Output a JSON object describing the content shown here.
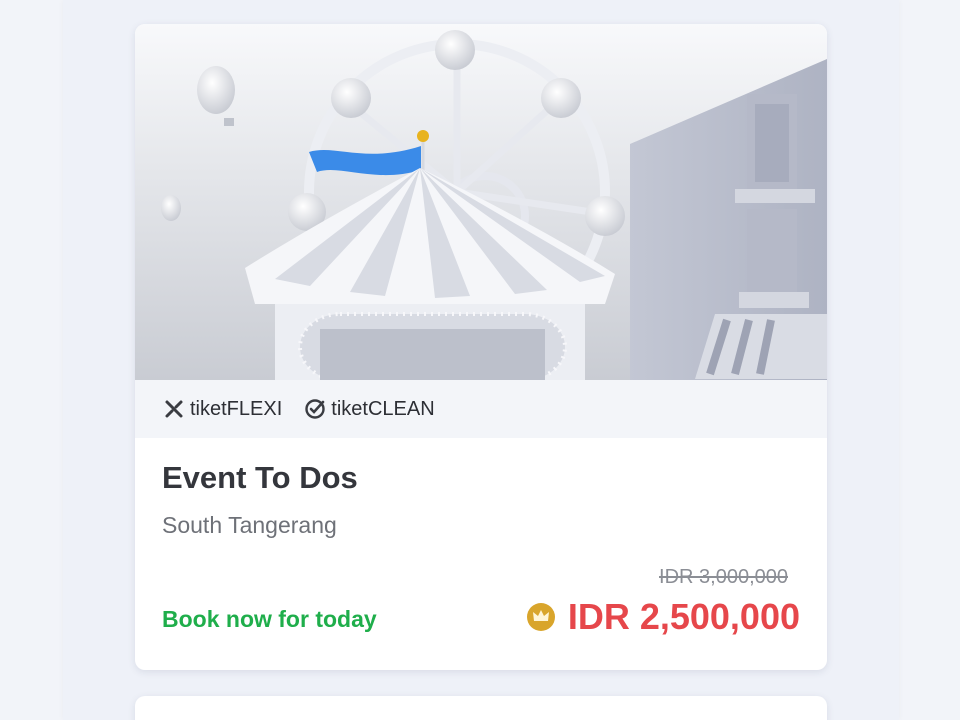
{
  "event": {
    "title": "Event To Dos",
    "location": "South Tangerang",
    "original_price": "IDR 3,000,000",
    "price": "IDR 2,500,000",
    "cta": "Book now for today"
  },
  "badges": [
    {
      "label": "tiketFLEXI",
      "icon": "flexi-icon"
    },
    {
      "label": "tiketCLEAN",
      "icon": "clean-check-icon"
    }
  ],
  "colors": {
    "price": "#e6474b",
    "cta": "#1fae4b",
    "crown": "#d9a52b",
    "flag": "#3b8be8"
  }
}
